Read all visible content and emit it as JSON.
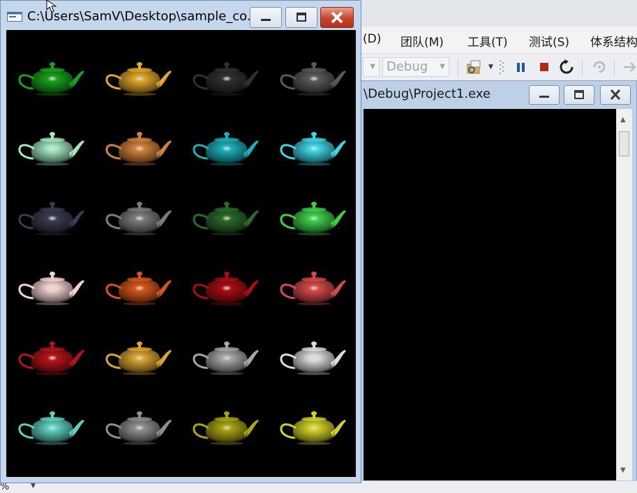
{
  "ide": {
    "menu": [
      "(D)",
      "团队(M)",
      "工具(T)",
      "测试(S)",
      "体系结构"
    ],
    "toolbar": {
      "config_combo": "Debug"
    },
    "console": {
      "title": "\\Debug\\Project1.exe"
    },
    "status": {
      "zoom": "%"
    }
  },
  "app": {
    "title": "C:\\Users\\SamV\\Desktop\\sample_co...",
    "background": "#000000",
    "teapot_colors": [
      [
        "#18a11c",
        "#e0a72a",
        "#303030",
        "#5a5a5a"
      ],
      [
        "#a3e8c2",
        "#d0813c",
        "#1ab0b8",
        "#3fd6e6"
      ],
      [
        "#3b3b52",
        "#7c7c7c",
        "#2a6a2a",
        "#3fd04a"
      ],
      [
        "#f4d2d2",
        "#d5561a",
        "#a80e12",
        "#d64a4a"
      ],
      [
        "#b51418",
        "#d9a434",
        "#a6a6a6",
        "#dcdcdc"
      ],
      [
        "#5fd1bf",
        "#8e8e8e",
        "#a8a412",
        "#d2d22a"
      ]
    ]
  }
}
